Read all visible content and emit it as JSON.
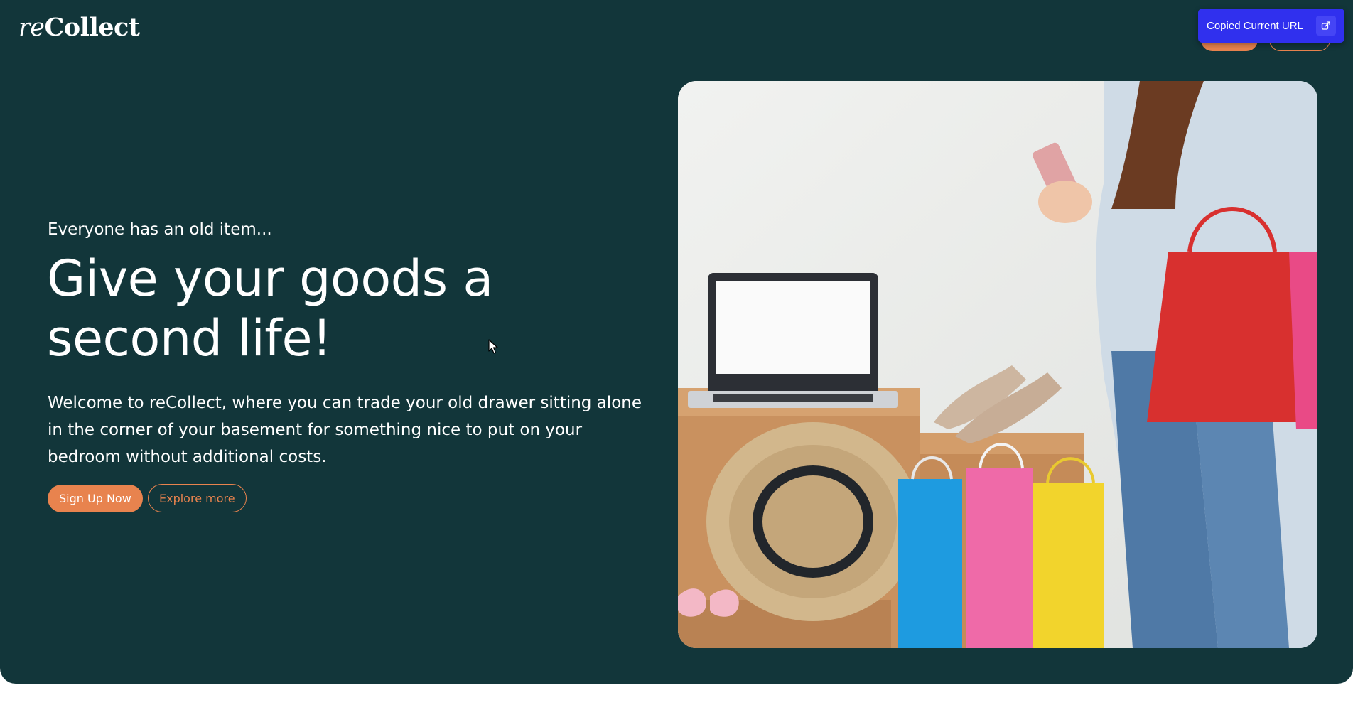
{
  "brand": {
    "logo_prefix": "re",
    "logo_main": "Collect"
  },
  "header": {
    "signup_label": "",
    "login_label": ""
  },
  "hero": {
    "eyebrow": "Everyone has an old item...",
    "headline": "Give your goods a second life!",
    "description": "Welcome to reCollect, where you can trade your old drawer sitting alone in the corner of your basement for something nice to put on your bedroom without additional costs.",
    "primary_button": "Sign Up Now",
    "secondary_button": "Explore more"
  },
  "toast": {
    "message": "Copied Current URL",
    "icon": "share-icon"
  },
  "colors": {
    "background": "#12363a",
    "accent": "#e8834e",
    "toast": "#3030ee",
    "text": "#ffffff"
  }
}
